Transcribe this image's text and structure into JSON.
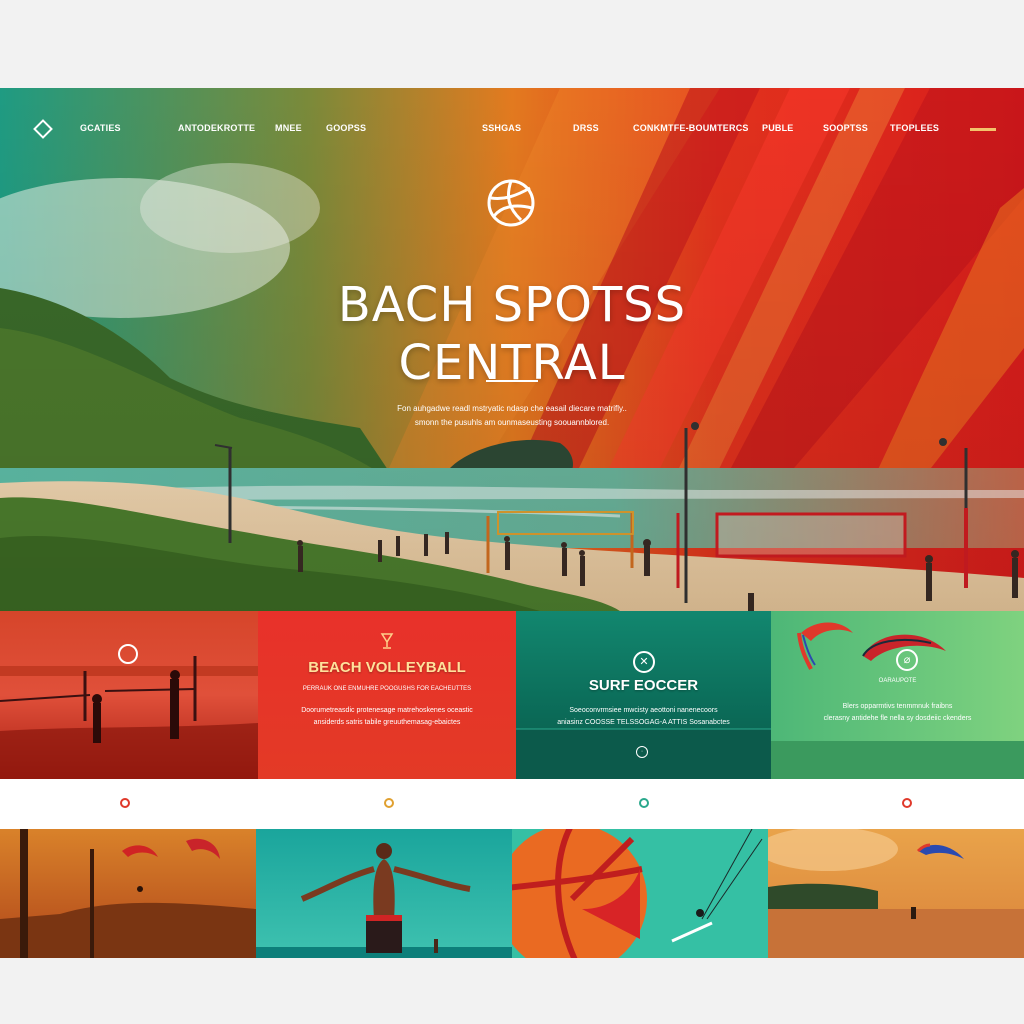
{
  "nav": {
    "items": [
      "GCATIES",
      "ANTODEKROTTE",
      "MNEE",
      "GOOPSS",
      "SSHGAS",
      "DRSS",
      "CONKMTFE-BOUMTERCS",
      "PUBLE",
      "SOOPTSS",
      "TFOPLEES"
    ]
  },
  "hero": {
    "title_line1": "BACH SPOTSS",
    "title_line2": "CENTRAL",
    "subtitle_line1": "Fon auhgadwe readl mstryatic ndasp che easail diecare matrifly..",
    "subtitle_line2": "smonn the pusuhls am ounmaseusting soouannblored."
  },
  "features": [
    {
      "title": "BEACH VOLLEYBALL",
      "tagline": "PERRAUK ONE ENMUHRE POOGUSHS FOR EACHEUTTES",
      "text_line1": "Doorumetreasdic protenesage matrehoskenes oceastic",
      "text_line2": "ansiderds satris tabile greuuthemasag-ebaictes"
    },
    {
      "title": "SURF EOCCER",
      "text_line1": "Soeoconvrmsiee mwcisty aeottoni nanenecoors",
      "text_line2": "aniasinz COOSSE TELSSOGAG-A ATTIS Sosanabctes"
    },
    {
      "title": "",
      "tagline": "OARAUPOTE",
      "text_line1": "Blers opparmtivs tenmmnuk fraibns",
      "text_line2": "clerasny antidehe fle nella sy dosdeiic ckenders"
    }
  ],
  "colors": {
    "teal": "#0f8a72",
    "orange": "#f07a1c",
    "red": "#e01e26",
    "green": "#6fc47a",
    "cream": "#ffe19b"
  },
  "icons": [
    "volleyball-icon",
    "diamond-logo-icon",
    "soccer-icon",
    "kite-icon"
  ]
}
